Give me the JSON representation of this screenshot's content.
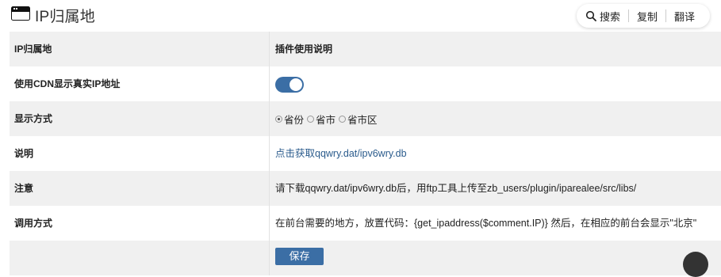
{
  "header": {
    "title": "IP归属地"
  },
  "toolbar": {
    "search": "搜索",
    "copy": "复制",
    "translate": "翻译"
  },
  "table": {
    "header": {
      "label": "IP归属地",
      "value": "插件使用说明"
    },
    "cdn": {
      "label": "使用CDN显示真实IP地址",
      "enabled": true
    },
    "display": {
      "label": "显示方式",
      "options": [
        "省份",
        "省市",
        "省市区"
      ],
      "selected": "省份"
    },
    "note": {
      "label": "说明",
      "link_text": "点击获取qqwry.dat/ipv6wry.db"
    },
    "attention": {
      "label": "注意",
      "text": "请下载qqwry.dat/ipv6wry.db后，用ftp工具上传至zb_users/plugin/iparealee/src/libs/"
    },
    "usage": {
      "label": "调用方式",
      "text": "在前台需要的地方，放置代码：{get_ipaddress($comment.IP)} 然后，在相应的前台会显示\"北京\""
    }
  },
  "save_button": {
    "label": "保存"
  },
  "colors": {
    "accent": "#3b6ea5",
    "link": "#2a5b8c",
    "row_alt": "#f0f0f0"
  }
}
